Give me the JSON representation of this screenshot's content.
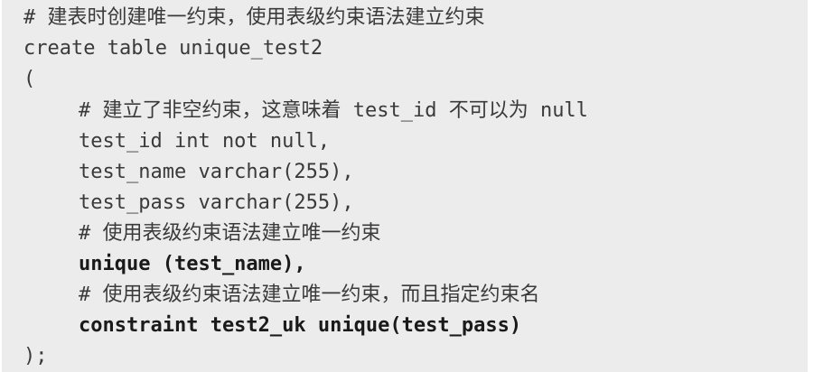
{
  "code": {
    "lines": [
      "# 建表时创建唯一约束，使用表级约束语法建立约束",
      "create table unique_test2",
      "(",
      "# 建立了非空约束，这意味着 test_id 不可以为 null",
      "test_id int not null,",
      "test_name varchar(255),",
      "test_pass varchar(255),",
      "# 使用表级约束语法建立唯一约束",
      "unique (test_name),",
      "# 使用表级约束语法建立唯一约束，而且指定约束名",
      "constraint test2_uk unique(test_pass)",
      ");"
    ]
  }
}
